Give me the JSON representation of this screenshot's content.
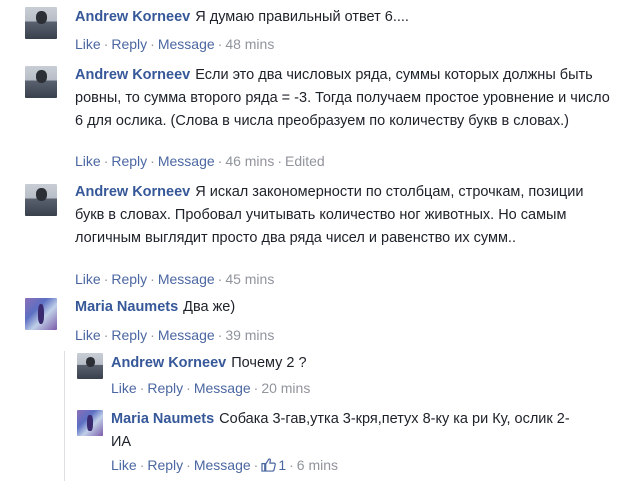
{
  "comments": [
    {
      "author": "Andrew Korneev",
      "text": "Я думаю правильный ответ 6....",
      "like": "Like",
      "reply": "Reply",
      "message": "Message",
      "time": "48 mins"
    },
    {
      "author": "Andrew Korneev",
      "text": "Если это два числовых ряда, суммы которых должны быть ровны, то сумма второго ряда = -3. Тогда получаем простое уровнение и число 6 для ослика. (Слова в числа преобразуем по количеству букв в словах.)",
      "like": "Like",
      "reply": "Reply",
      "message": "Message",
      "time": "46 mins",
      "edited": "Edited"
    },
    {
      "author": "Andrew Korneev",
      "text": "Я искал закономерности по столбцам, строчкам, позиции букв в словах. Пробовал учитывать количество ног животных. Но самым логичным выглядит просто два ряда чисел и равенство их сумм..",
      "like": "Like",
      "reply": "Reply",
      "message": "Message",
      "time": "45 mins"
    },
    {
      "author": "Maria Naumets",
      "text": "Два же)",
      "like": "Like",
      "reply": "Reply",
      "message": "Message",
      "time": "39 mins"
    }
  ],
  "replies": [
    {
      "author": "Andrew Korneev",
      "text": "Почему 2 ?",
      "like": "Like",
      "reply": "Reply",
      "message": "Message",
      "time": "20 mins"
    },
    {
      "author": "Maria Naumets",
      "text": "Собака 3-гав,утка 3-кря,петух 8-ку ка ри Ку, ослик 2- ИА",
      "like": "Like",
      "reply": "Reply",
      "message": "Message",
      "like_count": "1",
      "time": "6 mins"
    }
  ],
  "separator": "·",
  "colors": {
    "link": "#365899",
    "meta": "#90949c",
    "meta_link": "#4b67a1"
  }
}
